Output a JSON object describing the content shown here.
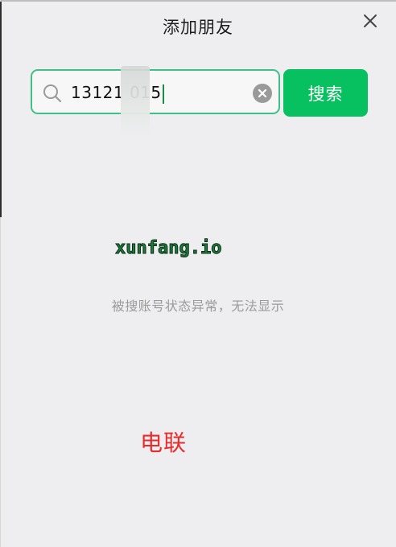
{
  "header": {
    "title": "添加朋友"
  },
  "search": {
    "value": "13121 015",
    "button_label": "搜索"
  },
  "result": {
    "message": "被搜账号状态异常，无法显示"
  },
  "overlays": {
    "watermark": "xunfang.io",
    "stamp": "电联"
  },
  "icons": {
    "search": "search-icon",
    "clear": "clear-icon",
    "close": "close-icon"
  },
  "colors": {
    "accent": "#07c160",
    "input_border": "#3fc08a",
    "background": "#eeeef1",
    "message_text": "#9b9b9b",
    "watermark_text": "#1d7a3a",
    "stamp_text": "#e82c2c"
  }
}
